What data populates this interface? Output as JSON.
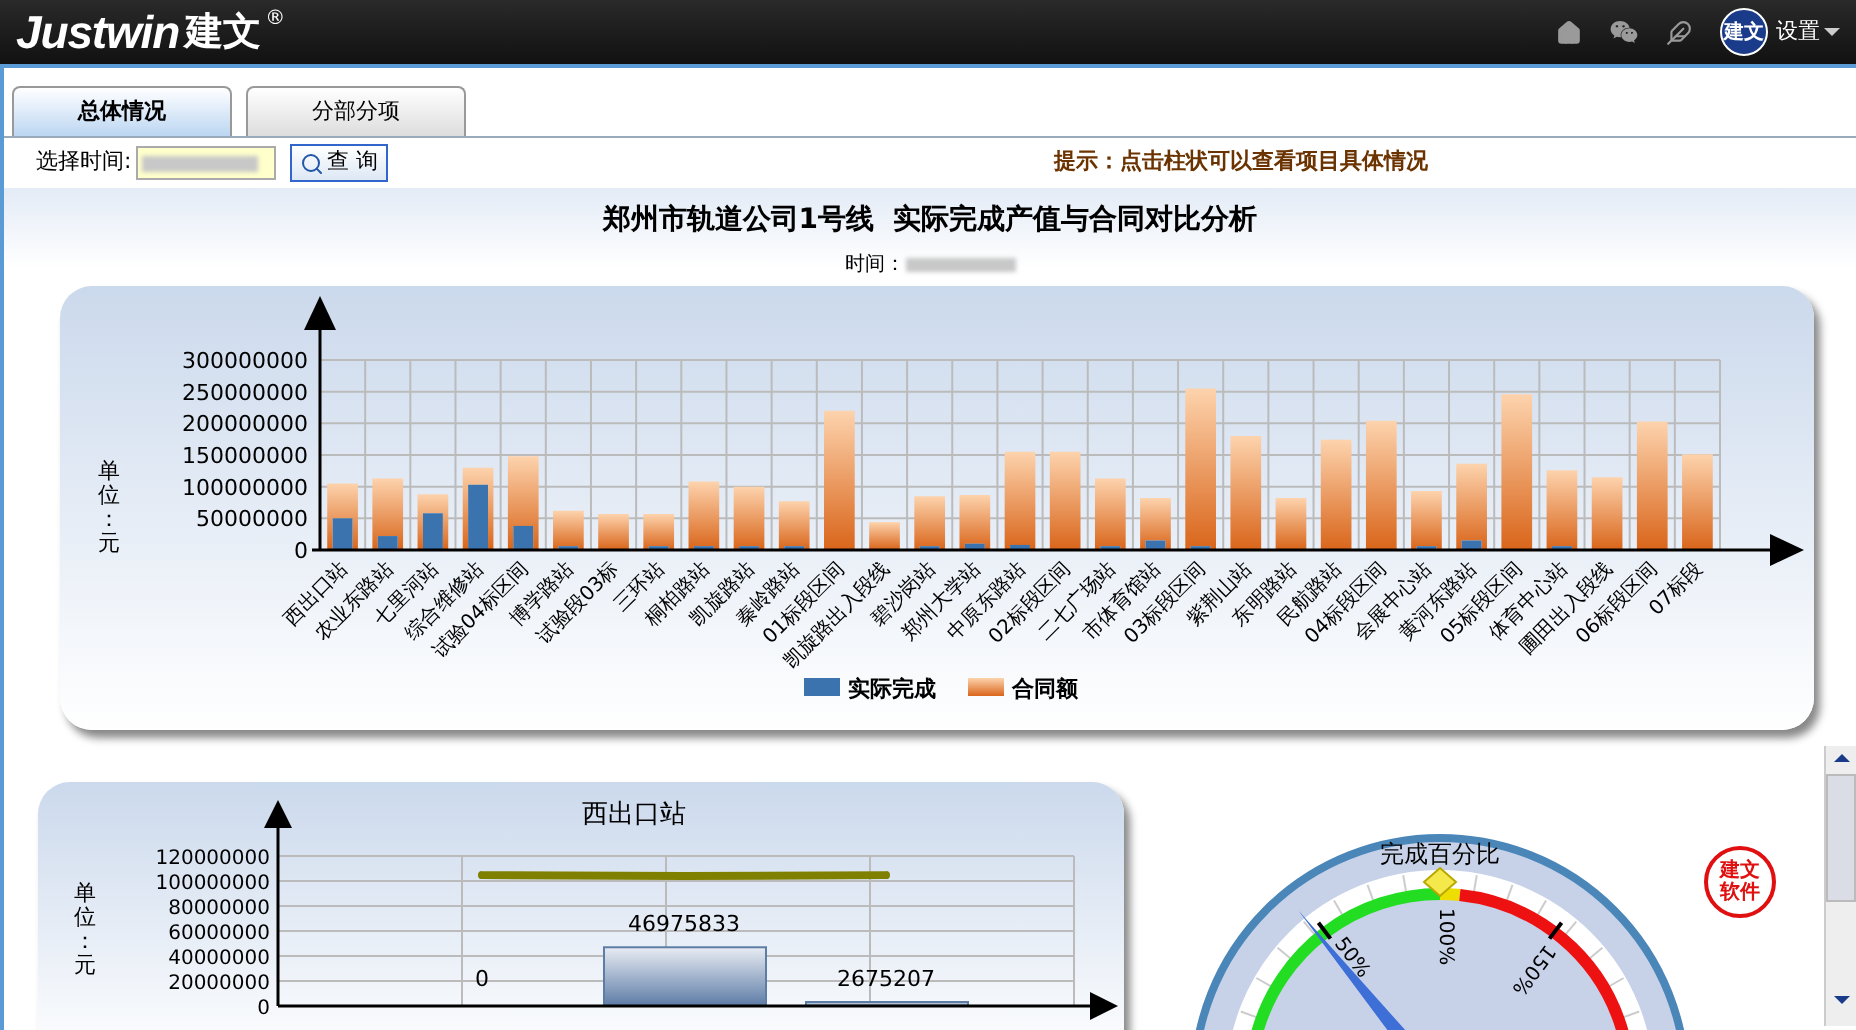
{
  "header": {
    "logo_text": "Justwin",
    "logo_cn": "建文",
    "logo_mark": "®",
    "avatar_text": "建文",
    "settings_label": "设置"
  },
  "tabs": [
    {
      "label": "总体情况",
      "selected": true
    },
    {
      "label": "分部分项",
      "selected": false
    }
  ],
  "filter": {
    "label": "选择时间:",
    "query_button": "查 询",
    "hint": "提示：点击柱状可以查看项目具体情况"
  },
  "report": {
    "title": "郑州市轨道公司1号线  实际完成产值与合同对比分析",
    "time_label": "时间："
  },
  "main_chart": {
    "chart_data": {
      "type": "bar",
      "ylabel": "单位：元",
      "categories": [
        "西出口站",
        "农业东路站",
        "七里河站",
        "综合维修站",
        "试验04标区间",
        "博学路站",
        "试验段03标",
        "三环站",
        "桐柏路站",
        "凯旋路站",
        "秦岭路站",
        "01标段区间",
        "凯旋路出入段线",
        "碧沙岗站",
        "郑州大学站",
        "中原东路站",
        "02标段区间",
        "二七广场站",
        "市体育馆站",
        "03标段区间",
        "紫荆山站",
        "东明路站",
        "民航路站",
        "04标段区间",
        "会展中心站",
        "黄河东路站",
        "05标段区间",
        "体育中心站",
        "圃田出入段线",
        "06标段区间",
        "07标段"
      ],
      "series": [
        {
          "name": "实际完成",
          "color": "#3a73ad",
          "values": [
            50000000,
            22000000,
            58000000,
            103000000,
            38000000,
            6000000,
            0,
            6000000,
            6000000,
            6000000,
            6000000,
            0,
            0,
            6000000,
            10000000,
            8000000,
            0,
            6000000,
            15000000,
            6000000,
            0,
            0,
            0,
            0,
            6000000,
            15000000,
            0,
            6000000,
            0,
            0,
            0
          ]
        },
        {
          "name": "合同额",
          "color": "#d9651a",
          "values": [
            105000000,
            113000000,
            88000000,
            130000000,
            148000000,
            62000000,
            57000000,
            57000000,
            108000000,
            100000000,
            77000000,
            220000000,
            44000000,
            85000000,
            87000000,
            155000000,
            155000000,
            113000000,
            82000000,
            255000000,
            180000000,
            82000000,
            174000000,
            204000000,
            93000000,
            136000000,
            246000000,
            126000000,
            115000000,
            203000000,
            151000000
          ]
        }
      ],
      "yticks": [
        0,
        50000000,
        100000000,
        150000000,
        200000000,
        250000000,
        300000000
      ],
      "ylim": [
        0,
        300000000
      ],
      "grid": true,
      "legend": true
    }
  },
  "station_chart": {
    "chart_data": {
      "type": "bar",
      "title": "西出口站",
      "ylabel": "单位：元",
      "value_labels": [
        [
          "0",
          "46975833",
          "2675207"
        ],
        [
          null,
          null,
          null
        ]
      ],
      "ylim": [
        0,
        120000000
      ],
      "grid": true,
      "series": [
        {
          "type": "bar",
          "color": "#5d7ca6",
          "values": [
            0,
            46975833,
            2675207
          ]
        },
        {
          "type": "line",
          "color": "#808000",
          "values": [
            104700000,
            104000000,
            104700000
          ]
        }
      ],
      "yticks": [
        0,
        20000000,
        40000000,
        60000000,
        80000000,
        100000000,
        120000000
      ]
    }
  },
  "gauge": {
    "title": "完成百分比",
    "labels": [
      "50%",
      "100%",
      "150%"
    ],
    "level": 0.235
  },
  "seal": {
    "text": "建文软件"
  }
}
